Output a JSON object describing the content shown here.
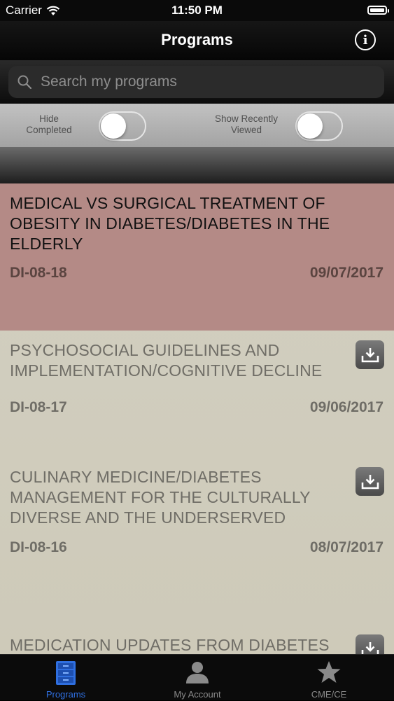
{
  "status_bar": {
    "carrier": "Carrier",
    "time": "11:50 PM"
  },
  "nav": {
    "title": "Programs",
    "info_icon": "info-icon"
  },
  "search": {
    "placeholder": "Search my programs",
    "value": ""
  },
  "filters": {
    "hide_completed": {
      "label_line1": "Hide",
      "label_line2": "Completed",
      "on": false
    },
    "show_recent": {
      "label_line1": "Show Recently",
      "label_line2": "Viewed",
      "on": false
    }
  },
  "programs": [
    {
      "title": "MEDICAL VS SURGICAL TREATMENT OF OBESITY IN DIABETES/DIABETES IN THE ELDERLY",
      "code": "DI-08-18",
      "date": "09/07/2017",
      "selected": true,
      "downloadable": false
    },
    {
      "title": "PSYCHOSOCIAL GUIDELINES AND IMPLEMENTATION/COGNITIVE DECLINE",
      "code": "DI-08-17",
      "date": "09/06/2017",
      "selected": false,
      "downloadable": true
    },
    {
      "title": "CULINARY MEDICINE/DIABETES MANAGEMENT FOR THE CULTURALLY DIVERSE AND THE UNDERSERVED",
      "code": "DI-08-16",
      "date": "08/07/2017",
      "selected": false,
      "downloadable": true
    },
    {
      "title": "MEDICATION UPDATES FROM DIABETES",
      "code": "",
      "date": "",
      "selected": false,
      "downloadable": true
    }
  ],
  "tabs": [
    {
      "label": "Programs",
      "icon": "file-cabinet-icon",
      "active": true
    },
    {
      "label": "My Account",
      "icon": "person-icon",
      "active": false
    },
    {
      "label": "CME/CE",
      "icon": "star-icon",
      "active": false
    }
  ],
  "colors": {
    "accent": "#2f6fe0",
    "selected_row": "#b48a86",
    "list_bg": "#d0ccbc"
  }
}
